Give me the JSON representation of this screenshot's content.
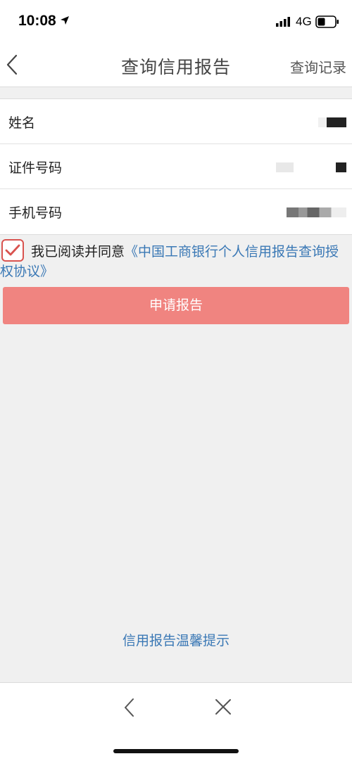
{
  "status_bar": {
    "time": "10:08",
    "network": "4G",
    "icons": [
      "location-arrow-icon",
      "signal-icon",
      "battery-icon"
    ]
  },
  "nav": {
    "title": "查询信用报告",
    "right_link": "查询记录",
    "back_icon": "chevron-left-icon"
  },
  "form": {
    "rows": [
      {
        "label": "姓名",
        "value_masked": true
      },
      {
        "label": "证件号码",
        "value_masked": true
      },
      {
        "label": "手机号码",
        "value_masked": true
      }
    ]
  },
  "agreement": {
    "checked": true,
    "prefix": "我已阅读并同意",
    "link": "《中国工商银行个人信用报告查询授权协议》"
  },
  "apply_button": {
    "label": "申请报告",
    "color": "#f08480"
  },
  "tips_link": "信用报告温馨提示",
  "bottom_bar": {
    "icons": [
      "chevron-left-icon",
      "close-icon"
    ]
  },
  "colors": {
    "accent_red": "#d9534f",
    "link_blue": "#3a78b5"
  }
}
